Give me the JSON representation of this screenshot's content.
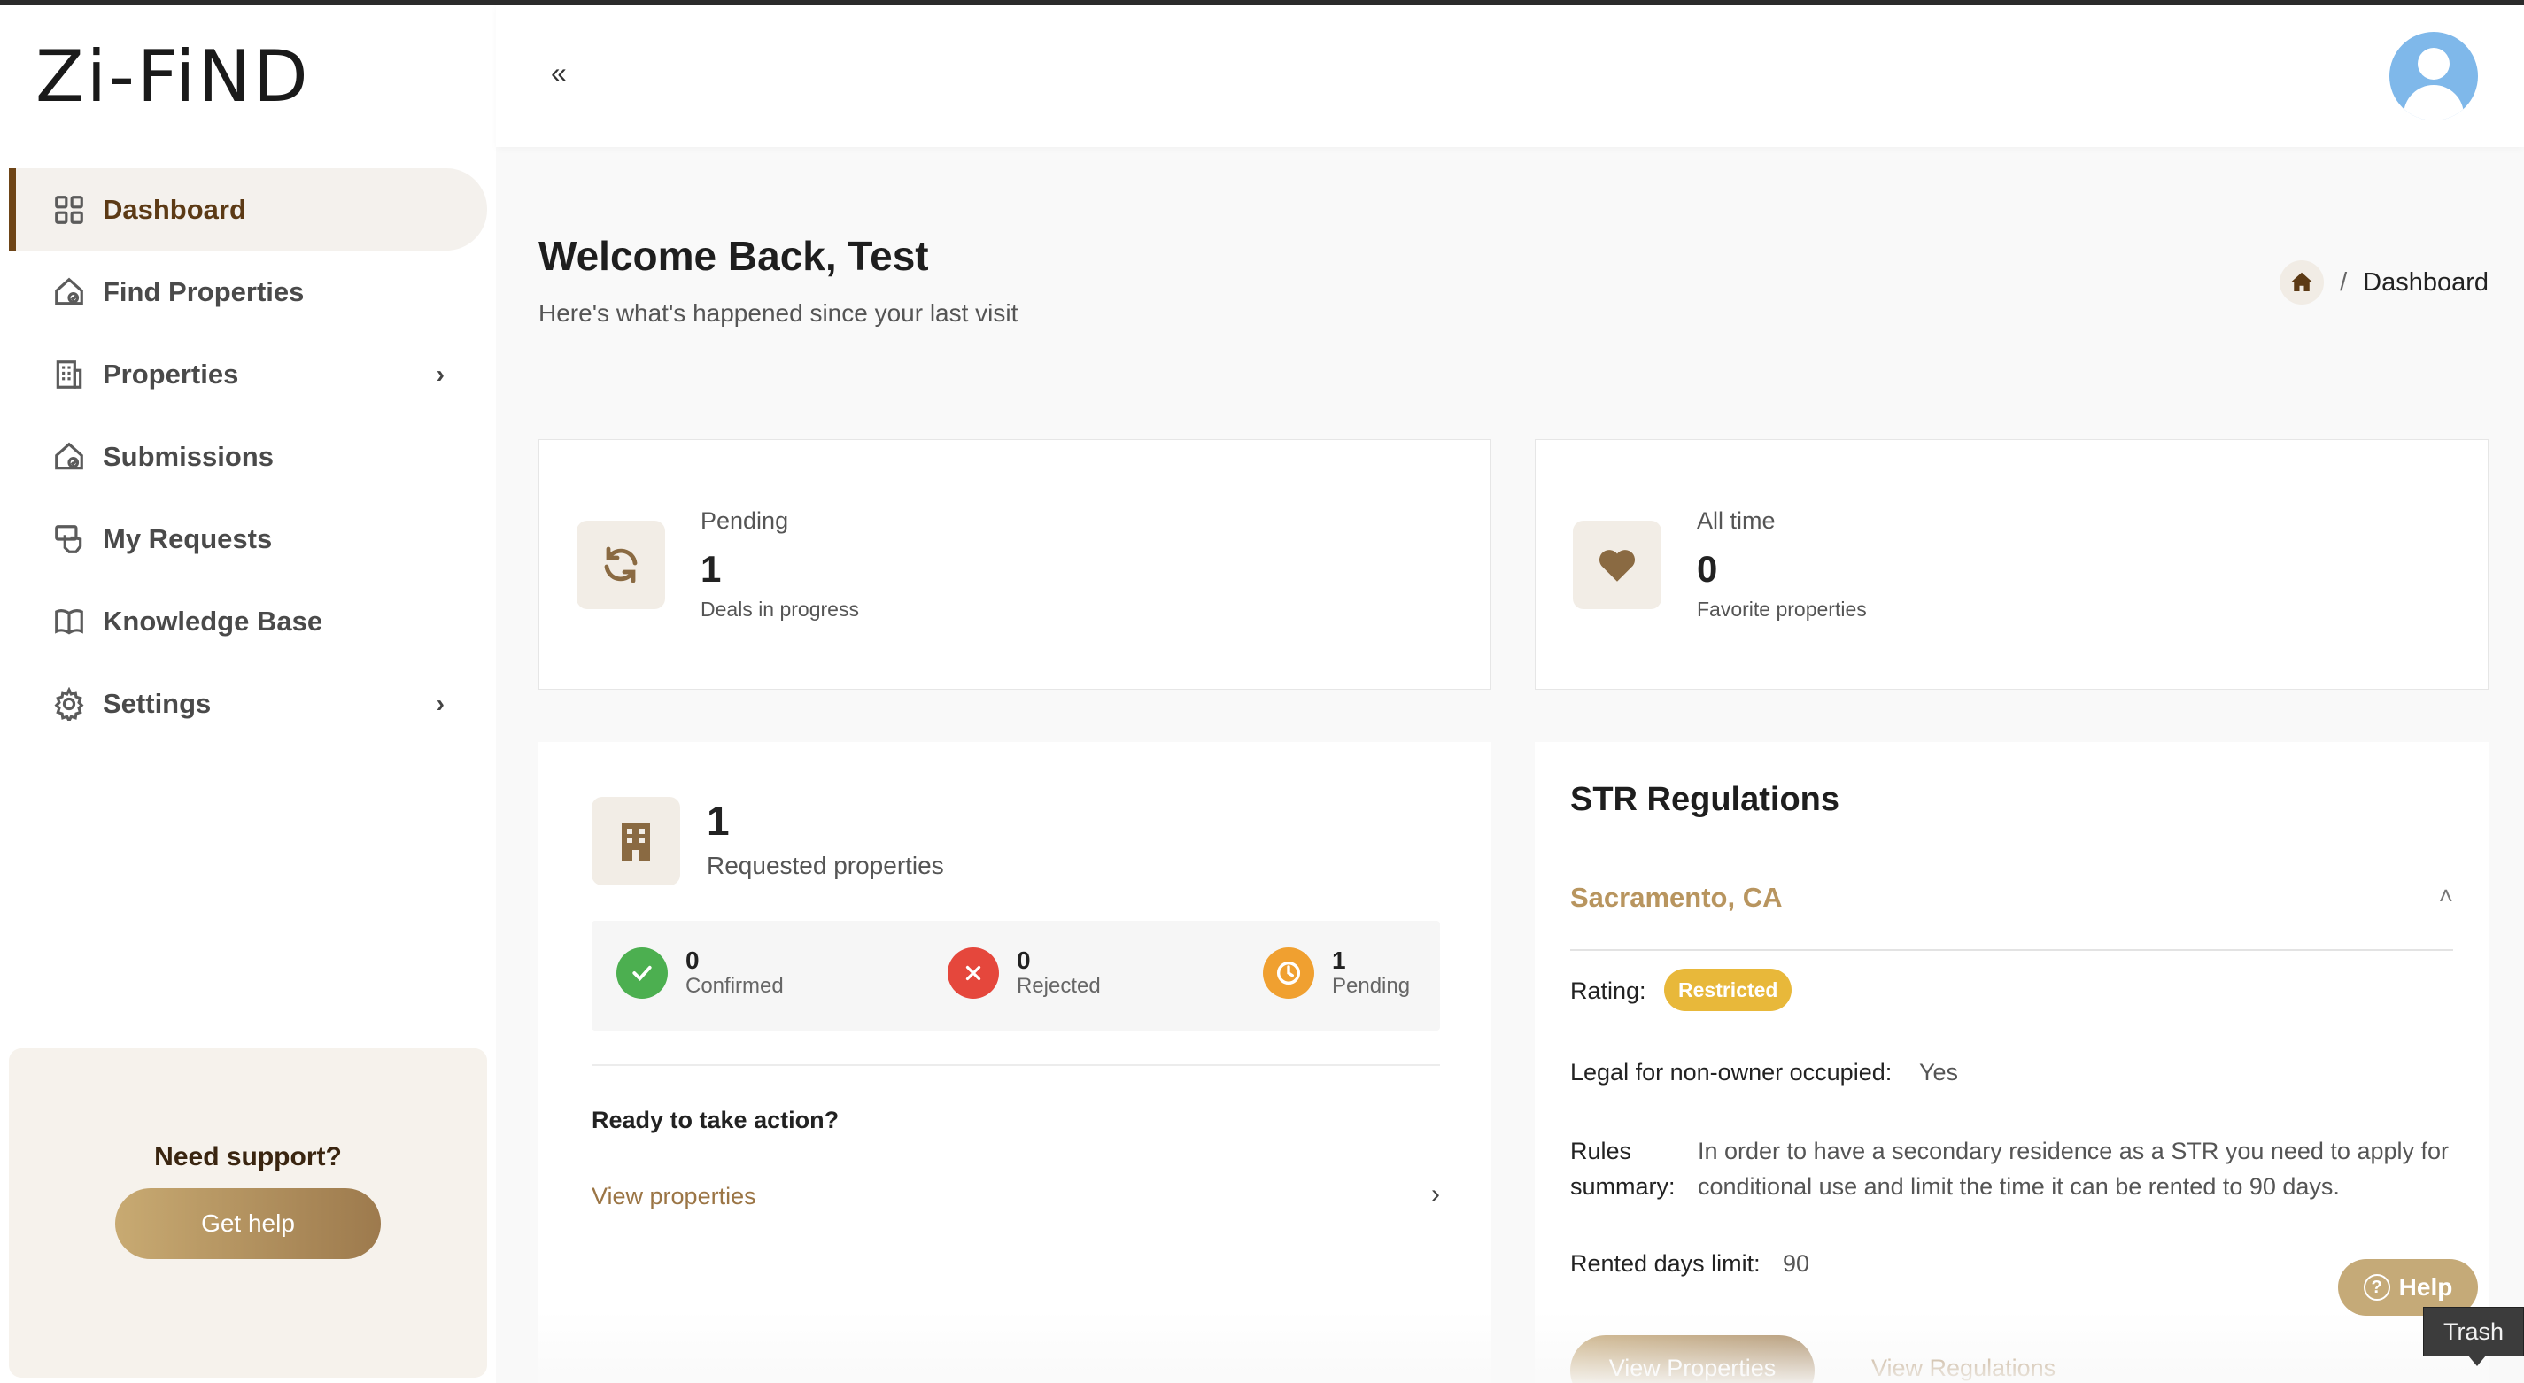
{
  "app": {
    "logo": "Zi-FiND"
  },
  "sidebar": {
    "items": [
      {
        "label": "Dashboard",
        "icon": "grid-icon",
        "active": true
      },
      {
        "label": "Find Properties",
        "icon": "house-search-icon"
      },
      {
        "label": "Properties",
        "icon": "building-icon",
        "has_submenu": true
      },
      {
        "label": "Submissions",
        "icon": "house-check-icon"
      },
      {
        "label": "My Requests",
        "icon": "hand-pointer-icon"
      },
      {
        "label": "Knowledge Base",
        "icon": "book-icon"
      },
      {
        "label": "Settings",
        "icon": "gear-icon",
        "has_submenu": true
      }
    ],
    "support": {
      "title": "Need support?",
      "button": "Get help"
    }
  },
  "topbar": {
    "collapse_glyph": "«"
  },
  "header": {
    "title": "Welcome Back, Test",
    "subtitle": "Here's what's happened since your last visit",
    "breadcrumb": {
      "separator": "/",
      "current": "Dashboard"
    }
  },
  "stats": [
    {
      "label": "Pending",
      "value": "1",
      "sub": "Deals in progress",
      "icon": "refresh-icon"
    },
    {
      "label": "All time",
      "value": "0",
      "sub": "Favorite properties",
      "icon": "heart-icon"
    }
  ],
  "requests": {
    "value": "1",
    "label": "Requested properties",
    "statuses": [
      {
        "value": "0",
        "label": "Confirmed",
        "color": "#4caf50"
      },
      {
        "value": "0",
        "label": "Rejected",
        "color": "#e5473c"
      },
      {
        "value": "1",
        "label": "Pending",
        "color": "#f0a030"
      }
    ],
    "cta_title": "Ready to take action?",
    "cta_link": "View properties"
  },
  "regulations": {
    "title": "STR Regulations",
    "city": "Sacramento, CA",
    "rating_label": "Rating:",
    "rating": "Restricted",
    "legal_label": "Legal for non-owner occupied:",
    "legal_value": "Yes",
    "rules_label_1": "Rules",
    "rules_label_2": "summary:",
    "rules_summary": "In order to have a secondary residence as a STR you need to apply for conditional use and limit the time it can be rented to 90 days.",
    "rented_label": "Rented days limit:",
    "rented_value": "90",
    "btn_properties": "View Properties",
    "link_regulations": "View Regulations"
  },
  "floating": {
    "help": "Help",
    "tooltip": "Trash"
  },
  "colors": {
    "accent": "#9d7a4d",
    "active_text": "#5c3a15",
    "badge": "#e8b83a"
  }
}
